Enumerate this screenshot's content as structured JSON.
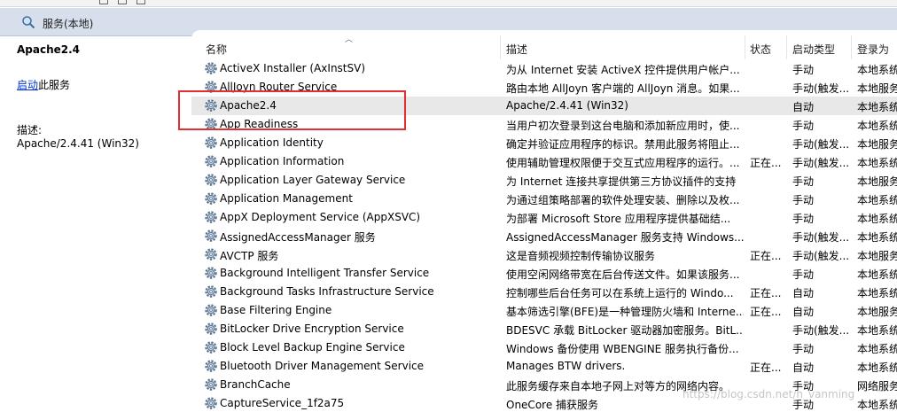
{
  "header": {
    "title": "服务(本地)"
  },
  "left_pane": {
    "service_name": "Apache2.4",
    "start_link": "启动",
    "start_suffix": "此服务",
    "desc_label": "描述:",
    "desc_value": "Apache/2.4.41 (Win32)"
  },
  "columns": {
    "name": "名称",
    "description": "描述",
    "status": "状态",
    "startup_type": "启动类型",
    "logon_as": "登录为"
  },
  "services": [
    {
      "name": "ActiveX Installer (AxInstSV)",
      "description": "为从 Internet 安装 ActiveX 控件提供用户帐户...",
      "status": "",
      "startup": "手动",
      "logon": "本地系统"
    },
    {
      "name": "AllJoyn Router Service",
      "description": "路由本地 AllJoyn 客户端的 AllJoyn 消息。如果...",
      "status": "",
      "startup": "手动(触发...",
      "logon": "本地服务"
    },
    {
      "name": "Apache2.4",
      "description": "Apache/2.4.41 (Win32)",
      "status": "",
      "startup": "自动",
      "logon": "本地系统"
    },
    {
      "name": "App Readiness",
      "description": "当用户初次登录到这台电脑和添加新应用时，使...",
      "status": "",
      "startup": "手动",
      "logon": "本地系统"
    },
    {
      "name": "Application Identity",
      "description": "确定并验证应用程序的标识。禁用此服务将阻止...",
      "status": "",
      "startup": "手动(触发...",
      "logon": "本地服务"
    },
    {
      "name": "Application Information",
      "description": "使用辅助管理权限便于交互式应用程序的运行。...",
      "status": "正在...",
      "startup": "手动(触发...",
      "logon": "本地系统"
    },
    {
      "name": "Application Layer Gateway Service",
      "description": "为 Internet 连接共享提供第三方协议插件的支持",
      "status": "",
      "startup": "手动",
      "logon": "本地服务"
    },
    {
      "name": "Application Management",
      "description": "为通过组策略部署的软件处理安装、删除以及枚...",
      "status": "",
      "startup": "手动",
      "logon": "本地系统"
    },
    {
      "name": "AppX Deployment Service (AppXSVC)",
      "description": "为部署 Microsoft Store 应用程序提供基础结...",
      "status": "",
      "startup": "手动",
      "logon": "本地系统"
    },
    {
      "name": "AssignedAccessManager 服务",
      "description": "AssignedAccessManager 服务支持 Windows...",
      "status": "",
      "startup": "手动(触发...",
      "logon": "本地系统"
    },
    {
      "name": "AVCTP 服务",
      "description": "这是音频视频控制传输协议服务",
      "status": "正在...",
      "startup": "手动(触发...",
      "logon": "本地服务"
    },
    {
      "name": "Background Intelligent Transfer Service",
      "description": "使用空闲网络带宽在后台传送文件。如果该服务...",
      "status": "",
      "startup": "手动",
      "logon": "本地系统"
    },
    {
      "name": "Background Tasks Infrastructure Service",
      "description": "控制哪些后台任务可以在系统上运行的 Windo...",
      "status": "正在...",
      "startup": "自动",
      "logon": "本地系统"
    },
    {
      "name": "Base Filtering Engine",
      "description": "基本筛选引擎(BFE)是一种管理防火墙和 Interne...",
      "status": "正在...",
      "startup": "自动",
      "logon": "本地服务"
    },
    {
      "name": "BitLocker Drive Encryption Service",
      "description": "BDESVC 承载 BitLocker 驱动器加密服务。BitL...",
      "status": "",
      "startup": "手动(触发...",
      "logon": "本地系统"
    },
    {
      "name": "Block Level Backup Engine Service",
      "description": "Windows 备份使用 WBENGINE 服务执行备份...",
      "status": "",
      "startup": "手动",
      "logon": "本地系统"
    },
    {
      "name": "Bluetooth Driver Management Service",
      "description": "Manages BTW drivers.",
      "status": "正在...",
      "startup": "自动",
      "logon": "本地系统"
    },
    {
      "name": "BranchCache",
      "description": "此服务缓存来自本地子网上对等方的网络内容。",
      "status": "",
      "startup": "手动",
      "logon": "网络服务"
    },
    {
      "name": "CaptureService_1f2a75",
      "description": "OneCore 捕获服务",
      "status": "",
      "startup": "手动",
      "logon": "本地系统"
    }
  ],
  "watermark": "https://blog.csdn.net/h_vanming"
}
